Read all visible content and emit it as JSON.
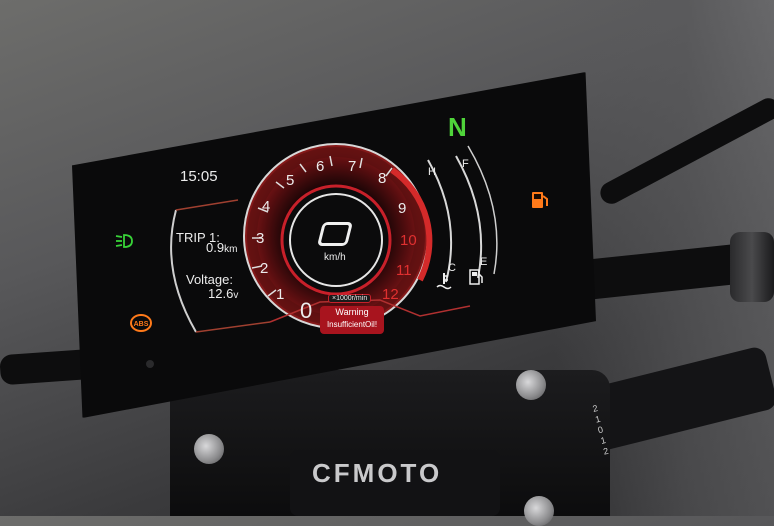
{
  "dashboard": {
    "time": "15:05",
    "trip_label": "TRIP 1:",
    "trip_value": "0.9",
    "trip_unit": "km",
    "voltage_label": "Voltage:",
    "voltage_value": "12.6",
    "voltage_unit": "v",
    "gear": "N",
    "speed_unit": "km/h",
    "rpm_unit": "×1000r/min",
    "rpm_ticks": [
      "0",
      "1",
      "2",
      "3",
      "4",
      "5",
      "6",
      "7",
      "8",
      "9",
      "10",
      "11",
      "12"
    ],
    "temp_high": "H",
    "temp_low": "C",
    "fuel_full": "F",
    "fuel_empty": "E",
    "warning_title": "Warning",
    "warning_message": "InsufficientOil!",
    "brand": "CFMOTO",
    "lever_marks": [
      "2",
      "1",
      "0",
      "1",
      "2"
    ]
  },
  "icons": {
    "headlight": "headlight-icon",
    "abs": "abs-warning-icon",
    "fuel": "fuel-pump-icon",
    "coolant": "coolant-temp-icon",
    "logo": "cfmoto-logo-icon"
  },
  "colors": {
    "gear_green": "#4fd43a",
    "redline": "#d42a2a",
    "warning_orange": "#ff7a1a",
    "indicator_green": "#38d338",
    "warning_box": "#a8141e"
  }
}
